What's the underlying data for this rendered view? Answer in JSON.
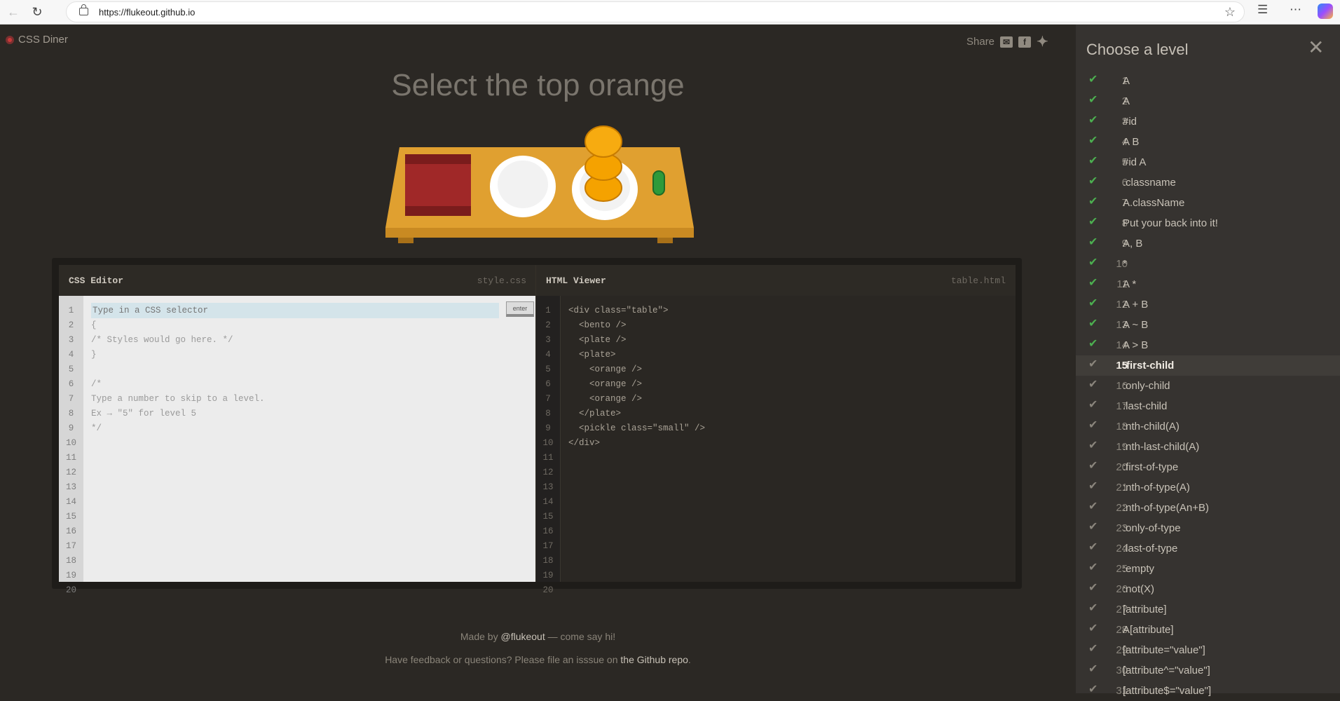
{
  "browser": {
    "url": "https://flukeout.github.io"
  },
  "app": {
    "logo_text": "CSS Diner",
    "share_label": "Share",
    "title": "Select the top orange"
  },
  "css_editor": {
    "title": "CSS Editor",
    "filename": "style.css",
    "placeholder": "Type in a CSS selector",
    "enter_label": "enter",
    "line_numbers": [
      "1",
      "2",
      "3",
      "4",
      "5",
      "6",
      "7",
      "8",
      "9",
      "10",
      "11",
      "12",
      "13",
      "14",
      "15",
      "16",
      "17",
      "18",
      "19",
      "20"
    ],
    "lines": [
      "",
      "{",
      "/* Styles would go here. */",
      "}",
      "",
      "/*",
      "Type a number to skip to a level.",
      "Ex → \"5\" for level 5",
      "*/"
    ]
  },
  "html_viewer": {
    "title": "HTML Viewer",
    "filename": "table.html",
    "line_numbers": [
      "1",
      "2",
      "3",
      "4",
      "5",
      "6",
      "7",
      "8",
      "9",
      "10",
      "11",
      "12",
      "13",
      "14",
      "15",
      "16",
      "17",
      "18",
      "19",
      "20"
    ],
    "lines": [
      "<div class=\"table\">",
      "  <bento />",
      "  <plate />",
      "  <plate>",
      "    <orange />",
      "    <orange />",
      "    <orange />",
      "  </plate>",
      "  <pickle class=\"small\" />",
      "</div>"
    ]
  },
  "footer": {
    "made_by_prefix": "Made by",
    "made_by_link": "@flukeout",
    "made_by_suffix": "— come say hi!",
    "feedback_prefix": "Have feedback or questions? Please file an isssue on",
    "feedback_link": "the Github repo",
    "feedback_suffix": "."
  },
  "sidebar": {
    "title": "Choose a level",
    "levels": [
      {
        "num": "1",
        "name": "A",
        "done": true
      },
      {
        "num": "2",
        "name": "A",
        "done": true
      },
      {
        "num": "3",
        "name": "#id",
        "done": true
      },
      {
        "num": "4",
        "name": "A  B",
        "done": true
      },
      {
        "num": "5",
        "name": "#id  A",
        "done": true
      },
      {
        "num": "6",
        "name": ".classname",
        "done": true
      },
      {
        "num": "7",
        "name": "A.className",
        "done": true
      },
      {
        "num": "8",
        "name": "Put your back into it!",
        "done": true
      },
      {
        "num": "9",
        "name": "A, B",
        "done": true
      },
      {
        "num": "10",
        "name": "*",
        "done": true
      },
      {
        "num": "11",
        "name": "A  *",
        "done": true
      },
      {
        "num": "12",
        "name": "A + B",
        "done": true
      },
      {
        "num": "13",
        "name": "A ~ B",
        "done": true
      },
      {
        "num": "14",
        "name": "A > B",
        "done": true
      },
      {
        "num": "15",
        "name": ":first-child",
        "done": false,
        "active": true
      },
      {
        "num": "16",
        "name": ":only-child",
        "done": false
      },
      {
        "num": "17",
        "name": ":last-child",
        "done": false
      },
      {
        "num": "18",
        "name": ":nth-child(A)",
        "done": false
      },
      {
        "num": "19",
        "name": ":nth-last-child(A)",
        "done": false
      },
      {
        "num": "20",
        "name": ":first-of-type",
        "done": false
      },
      {
        "num": "21",
        "name": ":nth-of-type(A)",
        "done": false
      },
      {
        "num": "22",
        "name": ":nth-of-type(An+B)",
        "done": false
      },
      {
        "num": "23",
        "name": ":only-of-type",
        "done": false
      },
      {
        "num": "24",
        "name": ":last-of-type",
        "done": false
      },
      {
        "num": "25",
        "name": ":empty",
        "done": false
      },
      {
        "num": "26",
        "name": ":not(X)",
        "done": false
      },
      {
        "num": "27",
        "name": "[attribute]",
        "done": false
      },
      {
        "num": "28",
        "name": "A[attribute]",
        "done": false
      },
      {
        "num": "29",
        "name": "[attribute=\"value\"]",
        "done": false
      },
      {
        "num": "30",
        "name": "[attribute^=\"value\"]",
        "done": false
      },
      {
        "num": "31",
        "name": "[attribute$=\"value\"]",
        "done": false
      }
    ]
  },
  "colors": {
    "background": "#2b2824",
    "sidebar": "#363330",
    "check_done": "#4caf50",
    "table_wood": "#e0a030",
    "orange": "#f5a200",
    "pickle": "#2e9a3a",
    "bento": "#a02828"
  }
}
